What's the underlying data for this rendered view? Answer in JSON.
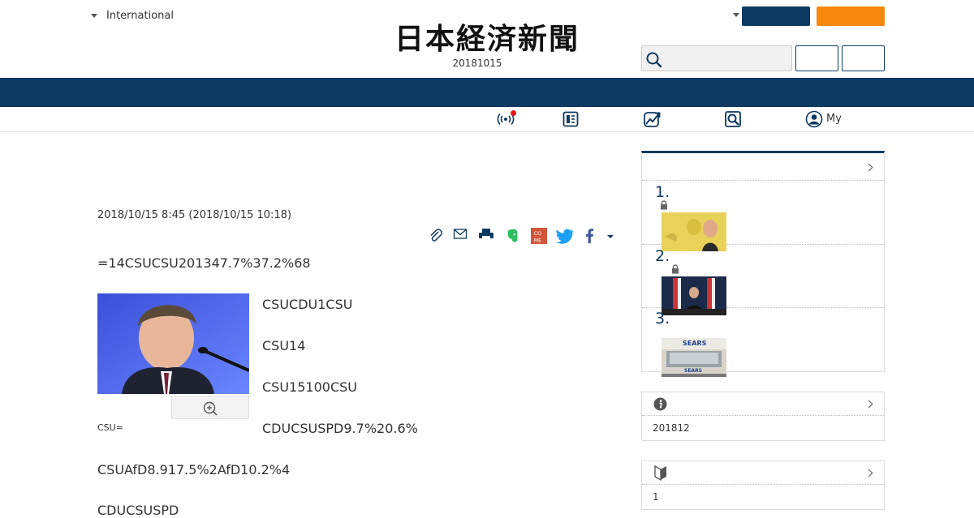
{
  "header": {
    "edition_label": "International",
    "logo_text": "日本経済新聞",
    "logo_date": "20181015",
    "search_placeholder": ""
  },
  "subnav": {
    "icons": [
      "live-icon",
      "paper-icon",
      "chart-icon",
      "search-icon",
      "user-icon"
    ],
    "my_label": "My"
  },
  "article": {
    "dateline": "2018/10/15 8:45 (2018/10/15 10:18)",
    "share_icons": [
      "clip-icon",
      "mail-icon",
      "print-icon",
      "evernote-icon",
      "comemo-icon",
      "twitter-icon",
      "facebook-icon",
      "more-caret-icon"
    ],
    "lead": "=14CSUCSU201347.7%37.2%68",
    "paragraphs": [
      "CSUCDU1CSU",
      "CSU14",
      "CSU15100CSU",
      "CDUCSUSPD9.7%20.6%"
    ],
    "caption": "CSU=",
    "after": [
      "CSUAfD8.917.5%2AfD10.2%4",
      "CDUCSUSPD"
    ]
  },
  "sidebar": {
    "ranking": [
      {
        "num": "1.",
        "locked": true
      },
      {
        "num": "2.",
        "locked": true
      },
      {
        "num": "3.",
        "locked": false
      }
    ],
    "info_box": {
      "body": "201812"
    },
    "beginner_box": {
      "body": "1"
    }
  },
  "colors": {
    "navy": "#0e3a61",
    "orange": "#f7880e",
    "live_red": "#e8141b",
    "evernote_green": "#2dbe60",
    "comemo_red": "#d3553a",
    "twitter_blue": "#1da1f2",
    "facebook_blue": "#3b5998"
  }
}
